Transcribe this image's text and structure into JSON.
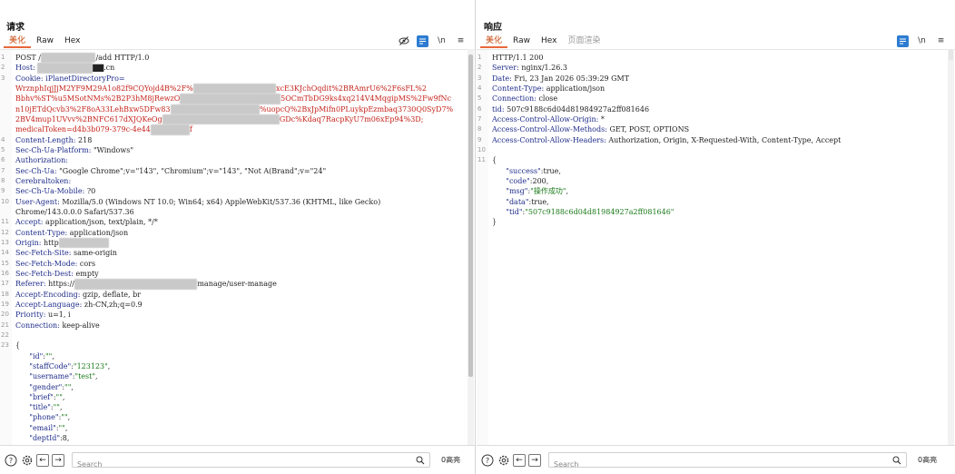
{
  "request": {
    "title": "请求",
    "tabs": [
      {
        "label": "美化",
        "active": true
      },
      {
        "label": "Raw"
      },
      {
        "label": "Hex"
      }
    ],
    "toolbar": {
      "wrap_label": "\\n",
      "menu": "≡"
    },
    "lines": [
      {
        "n": "1",
        "parts": [
          {
            "t": "POST /",
            "c": "v"
          },
          {
            "blur": "████ ███ ██"
          },
          {
            "t": "/add HTTP/1.0",
            "c": "v"
          }
        ]
      },
      {
        "n": "2",
        "parts": [
          {
            "t": "Host: ",
            "c": "k"
          },
          {
            "blur": "██████ ███ "
          },
          {
            "t": "▇▇.cn",
            "c": "v"
          }
        ]
      },
      {
        "n": "3",
        "parts": [
          {
            "t": "Cookie: ",
            "c": "k"
          },
          {
            "t": "iPlanetDirectoryPro=",
            "c": "k"
          }
        ]
      },
      {
        "n": "",
        "parts": [
          {
            "t": "WrznphIqjJjM2YF9M29A1o82f9CQYojd4B%2F%",
            "c": "red"
          },
          {
            "blur": "████████ ████ ██"
          },
          {
            "t": "xcE3KJchOqdit%2BRAmrU6%2F6sFL%2",
            "c": "red"
          }
        ]
      },
      {
        "n": "",
        "parts": [
          {
            "t": "Bbhv%ST%u5MSotNMs%2B2P3hM8jRewzO",
            "c": "red"
          },
          {
            "blur": "██████████████████"
          },
          {
            "t": "5OCmTbDG9ks4xq214V4MqgipMS%2Fw9fNc",
            "c": "red"
          }
        ]
      },
      {
        "n": "",
        "parts": [
          {
            "t": "n10jETdQcvb3%2F8oA33LehBxw5DFw83",
            "c": "red"
          },
          {
            "blur": "████████████████"
          },
          {
            "t": "%uopcQ%2BxJpMifn0PLuykpEzmbaq3730Q0SyD7%",
            "c": "red"
          }
        ]
      },
      {
        "n": "",
        "parts": [
          {
            "t": "2BV4mup1UVvv%2BNFC617dXJQKeOg",
            "c": "red"
          },
          {
            "blur": "█████████████████████"
          },
          {
            "t": "GDc%Kdaq7RacpKyU7m06xEp94%3D;",
            "c": "red"
          }
        ]
      },
      {
        "n": "",
        "parts": [
          {
            "t": "medicalToken=d4b3b079-379c-4e44",
            "c": "red"
          },
          {
            "blur": "███████"
          },
          {
            "t": "f",
            "c": "red"
          }
        ]
      },
      {
        "n": "4",
        "parts": [
          {
            "t": "Content-Length: ",
            "c": "k"
          },
          {
            "t": "218",
            "c": "v"
          }
        ]
      },
      {
        "n": "5",
        "parts": [
          {
            "t": "Sec-Ch-Ua-Platform: ",
            "c": "k"
          },
          {
            "t": "\"Windows\"",
            "c": "v"
          }
        ]
      },
      {
        "n": "6",
        "parts": [
          {
            "t": "Authorization:",
            "c": "k"
          }
        ]
      },
      {
        "n": "7",
        "parts": [
          {
            "t": "Sec-Ch-Ua: ",
            "c": "k"
          },
          {
            "t": "\"Google Chrome\";v=\"143\", \"Chromium\";v=\"143\", \"Not A(Brand\";v=\"24\"",
            "c": "v"
          }
        ]
      },
      {
        "n": "8",
        "parts": [
          {
            "t": "Cerebraltoken:",
            "c": "k"
          }
        ]
      },
      {
        "n": "9",
        "parts": [
          {
            "t": "Sec-Ch-Ua-Mobile: ",
            "c": "k"
          },
          {
            "t": "?0",
            "c": "v"
          }
        ]
      },
      {
        "n": "10",
        "parts": [
          {
            "t": "User-Agent: ",
            "c": "k"
          },
          {
            "t": "Mozilla/5.0 (Windows NT 10.0; Win64; x64) AppleWebKit/537.36 (KHTML, like Gecko)",
            "c": "v"
          }
        ]
      },
      {
        "n": "",
        "parts": [
          {
            "t": "Chrome/143.0.0.0 Safari/537.36",
            "c": "v"
          }
        ]
      },
      {
        "n": "11",
        "parts": [
          {
            "t": "Accept: ",
            "c": "k"
          },
          {
            "t": "application/json, text/plain, */*",
            "c": "v"
          }
        ]
      },
      {
        "n": "12",
        "parts": [
          {
            "t": "Content-Type: ",
            "c": "k"
          },
          {
            "t": "application/json",
            "c": "v"
          }
        ]
      },
      {
        "n": "13",
        "parts": [
          {
            "t": "Origin: ",
            "c": "k"
          },
          {
            "t": "http",
            "c": "v"
          },
          {
            "blur": "█████████"
          }
        ]
      },
      {
        "n": "14",
        "parts": [
          {
            "t": "Sec-Fetch-Site: ",
            "c": "k"
          },
          {
            "t": "same-origin",
            "c": "v"
          }
        ]
      },
      {
        "n": "15",
        "parts": [
          {
            "t": "Sec-Fetch-Mode: ",
            "c": "k"
          },
          {
            "t": "cors",
            "c": "v"
          }
        ]
      },
      {
        "n": "16",
        "parts": [
          {
            "t": "Sec-Fetch-Dest: ",
            "c": "k"
          },
          {
            "t": "empty",
            "c": "v"
          }
        ]
      },
      {
        "n": "17",
        "parts": [
          {
            "t": "Referer: ",
            "c": "k"
          },
          {
            "t": "https://",
            "c": "v"
          },
          {
            "blur": "██████████████████████"
          },
          {
            "t": "manage/user-manage",
            "c": "v"
          }
        ]
      },
      {
        "n": "18",
        "parts": [
          {
            "t": "Accept-Encoding: ",
            "c": "k"
          },
          {
            "t": "gzip, deflate, br",
            "c": "v"
          }
        ]
      },
      {
        "n": "19",
        "parts": [
          {
            "t": "Accept-Language: ",
            "c": "k"
          },
          {
            "t": "zh-CN,zh;q=0.9",
            "c": "v"
          }
        ]
      },
      {
        "n": "20",
        "parts": [
          {
            "t": "Priority: ",
            "c": "k"
          },
          {
            "t": "u=1, i",
            "c": "v"
          }
        ]
      },
      {
        "n": "21",
        "parts": [
          {
            "t": "Connection: ",
            "c": "k"
          },
          {
            "t": "keep-alive",
            "c": "v"
          }
        ]
      },
      {
        "n": "22",
        "parts": []
      },
      {
        "n": "23",
        "parts": [
          {
            "t": "{",
            "c": "punct"
          }
        ]
      },
      {
        "n": "",
        "parts": [
          {
            "t": "      \"id\"",
            "c": "key"
          },
          {
            "t": ":",
            "c": "punct"
          },
          {
            "t": "\"\"",
            "c": "str"
          },
          {
            "t": ",",
            "c": "punct"
          }
        ]
      },
      {
        "n": "",
        "parts": [
          {
            "t": "      \"staffCode\"",
            "c": "key"
          },
          {
            "t": ":",
            "c": "punct"
          },
          {
            "t": "\"123123\"",
            "c": "str"
          },
          {
            "t": ",",
            "c": "punct"
          }
        ]
      },
      {
        "n": "",
        "parts": [
          {
            "t": "      \"username\"",
            "c": "key"
          },
          {
            "t": ":",
            "c": "punct"
          },
          {
            "t": "\"test\"",
            "c": "str"
          },
          {
            "t": ",",
            "c": "punct"
          }
        ]
      },
      {
        "n": "",
        "parts": [
          {
            "t": "      \"gender\"",
            "c": "key"
          },
          {
            "t": ":",
            "c": "punct"
          },
          {
            "t": "\"\"",
            "c": "str"
          },
          {
            "t": ",",
            "c": "punct"
          }
        ]
      },
      {
        "n": "",
        "parts": [
          {
            "t": "      \"brief\"",
            "c": "key"
          },
          {
            "t": ":",
            "c": "punct"
          },
          {
            "t": "\"\"",
            "c": "str"
          },
          {
            "t": ",",
            "c": "punct"
          }
        ]
      },
      {
        "n": "",
        "parts": [
          {
            "t": "      \"title\"",
            "c": "key"
          },
          {
            "t": ":",
            "c": "punct"
          },
          {
            "t": "\"\"",
            "c": "str"
          },
          {
            "t": ",",
            "c": "punct"
          }
        ]
      },
      {
        "n": "",
        "parts": [
          {
            "t": "      \"phone\"",
            "c": "key"
          },
          {
            "t": ":",
            "c": "punct"
          },
          {
            "t": "\"\"",
            "c": "str"
          },
          {
            "t": ",",
            "c": "punct"
          }
        ]
      },
      {
        "n": "",
        "parts": [
          {
            "t": "      \"email\"",
            "c": "key"
          },
          {
            "t": ":",
            "c": "punct"
          },
          {
            "t": "\"\"",
            "c": "str"
          },
          {
            "t": ",",
            "c": "punct"
          }
        ]
      },
      {
        "n": "",
        "parts": [
          {
            "t": "      \"deptId\"",
            "c": "key"
          },
          {
            "t": ":",
            "c": "punct"
          },
          {
            "t": "8",
            "c": "v"
          },
          {
            "t": ",",
            "c": "punct"
          }
        ]
      }
    ],
    "search_placeholder": "Search",
    "highlight_count": "0高亮"
  },
  "response": {
    "title": "响应",
    "tabs": [
      {
        "label": "美化",
        "active": true
      },
      {
        "label": "Raw"
      },
      {
        "label": "Hex"
      },
      {
        "label": "页面渲染",
        "disabled": true
      }
    ],
    "toolbar": {
      "wrap_label": "\\n",
      "menu": "≡"
    },
    "lines": [
      {
        "n": "1",
        "parts": [
          {
            "t": "HTTP/1.1 200",
            "c": "v"
          }
        ]
      },
      {
        "n": "2",
        "parts": [
          {
            "t": "Server: ",
            "c": "k"
          },
          {
            "t": "nginx/1.26.3",
            "c": "v"
          }
        ]
      },
      {
        "n": "3",
        "parts": [
          {
            "t": "Date: ",
            "c": "k"
          },
          {
            "t": "Fri, 23 Jan 2026 05:39:29 GMT",
            "c": "v"
          }
        ]
      },
      {
        "n": "4",
        "parts": [
          {
            "t": "Content-Type: ",
            "c": "k"
          },
          {
            "t": "application/json",
            "c": "v"
          }
        ]
      },
      {
        "n": "5",
        "parts": [
          {
            "t": "Connection: ",
            "c": "k"
          },
          {
            "t": "close",
            "c": "v"
          }
        ]
      },
      {
        "n": "6",
        "parts": [
          {
            "t": "tid: ",
            "c": "k"
          },
          {
            "t": "507c9188c6d04d81984927a2ff081646",
            "c": "v"
          }
        ]
      },
      {
        "n": "7",
        "parts": [
          {
            "t": "Access-Control-Allow-Origin: ",
            "c": "k"
          },
          {
            "t": "*",
            "c": "v"
          }
        ]
      },
      {
        "n": "8",
        "parts": [
          {
            "t": "Access-Control-Allow-Methods: ",
            "c": "k"
          },
          {
            "t": "GET, POST, OPTIONS",
            "c": "v"
          }
        ]
      },
      {
        "n": "9",
        "parts": [
          {
            "t": "Access-Control-Allow-Headers: ",
            "c": "k"
          },
          {
            "t": "Authorization, Origin, X-Requested-With, Content-Type, Accept",
            "c": "v"
          }
        ]
      },
      {
        "n": "10",
        "parts": []
      },
      {
        "n": "11",
        "parts": [
          {
            "t": "{",
            "c": "punct"
          }
        ]
      },
      {
        "n": "",
        "parts": [
          {
            "t": "      \"success\"",
            "c": "key"
          },
          {
            "t": ":",
            "c": "punct"
          },
          {
            "t": "true",
            "c": "v"
          },
          {
            "t": ",",
            "c": "punct"
          }
        ]
      },
      {
        "n": "",
        "parts": [
          {
            "t": "      \"code\"",
            "c": "key"
          },
          {
            "t": ":",
            "c": "punct"
          },
          {
            "t": "200",
            "c": "v"
          },
          {
            "t": ",",
            "c": "punct"
          }
        ]
      },
      {
        "n": "",
        "parts": [
          {
            "t": "      \"msg\"",
            "c": "key"
          },
          {
            "t": ":",
            "c": "punct"
          },
          {
            "t": "\"操作成功\"",
            "c": "str"
          },
          {
            "t": ",",
            "c": "punct"
          }
        ]
      },
      {
        "n": "",
        "parts": [
          {
            "t": "      \"data\"",
            "c": "key"
          },
          {
            "t": ":",
            "c": "punct"
          },
          {
            "t": "true",
            "c": "v"
          },
          {
            "t": ",",
            "c": "punct"
          }
        ]
      },
      {
        "n": "",
        "parts": [
          {
            "t": "      \"tid\"",
            "c": "key"
          },
          {
            "t": ":",
            "c": "punct"
          },
          {
            "t": "\"507c9188c6d04d81984927a2ff081646\"",
            "c": "str"
          }
        ]
      },
      {
        "n": "",
        "parts": [
          {
            "t": "}",
            "c": "punct"
          }
        ]
      }
    ],
    "search_placeholder": "Search",
    "highlight_count": "0高亮"
  },
  "colors": {
    "accent": "#2d7cd1",
    "active_tab": "#e8673b",
    "cookie_red": "#c4231b",
    "header_key": "#1f2d8a",
    "json_string": "#1a7a1a"
  },
  "icons": [
    "layout-columns-icon",
    "layout-rows-icon",
    "layout-tabs-icon",
    "eye-slash-icon",
    "wrap-toggle-icon",
    "newline-icon",
    "menu-icon",
    "help-icon",
    "settings-icon",
    "back-arrow-icon",
    "forward-arrow-icon",
    "search-icon"
  ]
}
